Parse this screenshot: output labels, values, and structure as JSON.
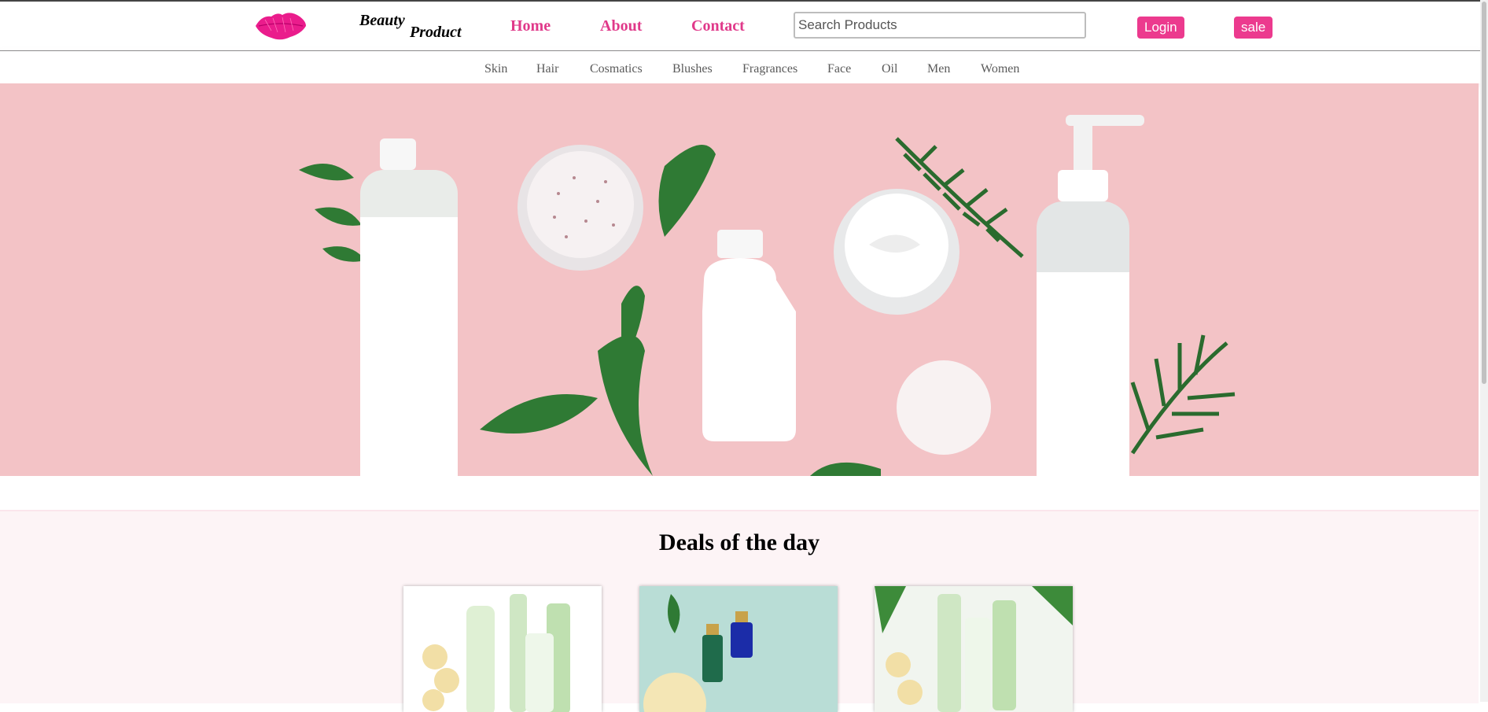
{
  "brand": {
    "line1": "Beauty",
    "line2": "Product"
  },
  "nav": {
    "home": "Home",
    "about": "About",
    "contact": "Contact"
  },
  "search": {
    "placeholder": "Search Products",
    "value": ""
  },
  "buttons": {
    "login": "Login",
    "sale": "sale"
  },
  "categories": [
    "Skin",
    "Hair",
    "Cosmatics",
    "Blushes",
    "Fragrances",
    "Face",
    "Oil",
    "Men",
    "Women"
  ],
  "deals": {
    "title": "Deals of the day"
  },
  "colors": {
    "accent": "#ec3a8e",
    "nav_link": "#e0398a",
    "hero_bg": "#f3c3c6",
    "deals_bg": "#fdf4f6"
  }
}
